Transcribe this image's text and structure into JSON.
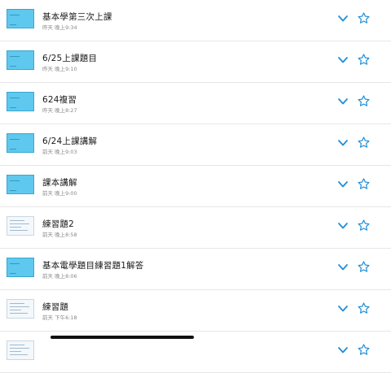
{
  "colors": {
    "accent": "#1e8ed8",
    "thumb_blue": "#5ec8ee"
  },
  "notes": [
    {
      "title": "基本學第三次上課",
      "subtitle": "昨天 晚上9:34",
      "thumb": "blue"
    },
    {
      "title": "6/25上課題目",
      "subtitle": "昨天 晚上9:10",
      "thumb": "blue"
    },
    {
      "title": "624複習",
      "subtitle": "昨天 晚上8:27",
      "thumb": "blue"
    },
    {
      "title": "6/24上課講解",
      "subtitle": "前天 晚上9:03",
      "thumb": "blue"
    },
    {
      "title": "課本講解",
      "subtitle": "前天 晚上9:00",
      "thumb": "blue"
    },
    {
      "title": "練習題2",
      "subtitle": "前天 晚上8:58",
      "thumb": "paper"
    },
    {
      "title": "基本電學題目練習題1解答",
      "subtitle": "前天 晚上8:06",
      "thumb": "blue"
    },
    {
      "title": "練習題",
      "subtitle": "前天 下午6:18",
      "thumb": "paper"
    },
    {
      "title": "",
      "subtitle": "",
      "thumb": "paper"
    }
  ],
  "icons": {
    "expand": "chevron-down-icon",
    "favorite": "star-outline-icon"
  }
}
